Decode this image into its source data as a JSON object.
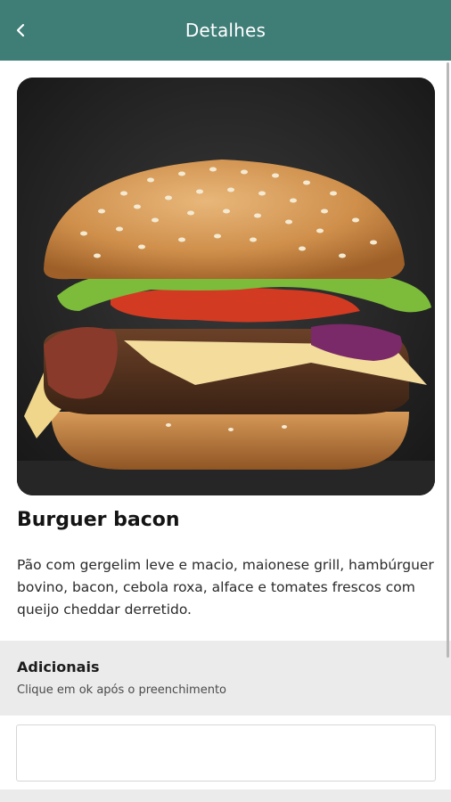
{
  "header": {
    "title": "Detalhes",
    "back_icon": "chevron-left-icon",
    "color": "#3f7d77"
  },
  "product": {
    "image_alt": "burger-photo",
    "name": "Burguer bacon",
    "description": "Pão com gergelim leve e macio, maionese grill, hambúrguer bovino, bacon, cebola roxa, alface e tomates frescos com queijo cheddar derretido."
  },
  "additions": {
    "title": "Adicionais",
    "hint": "Clique em ok após o preenchimento",
    "input_value": ""
  }
}
